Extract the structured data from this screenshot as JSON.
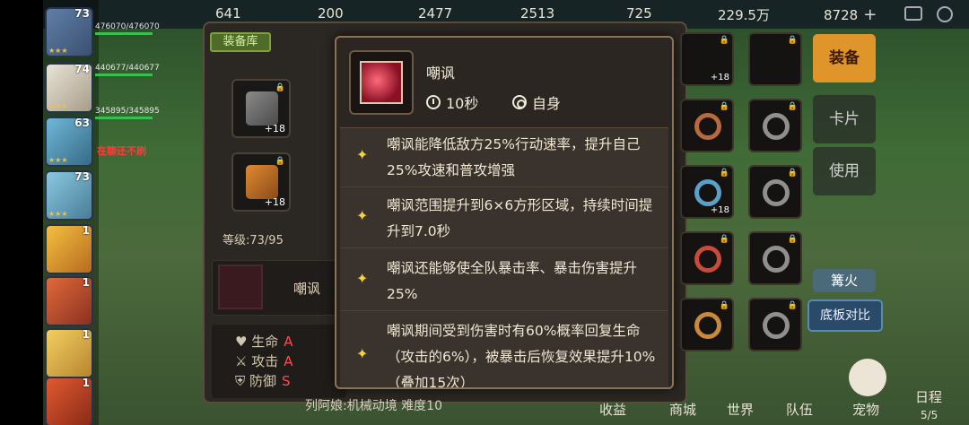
{
  "topbar": {
    "resources": [
      "641",
      "200",
      "2477",
      "2513",
      "725",
      "229.5万",
      "8728"
    ],
    "plus": "+"
  },
  "heroes": [
    {
      "level": "73",
      "hp": "476070/476070"
    },
    {
      "level": "74",
      "hp": "440677/440677"
    },
    {
      "level": "",
      "hp": "345895/345895"
    },
    {
      "level": "63",
      "hp": ""
    },
    {
      "level": "73",
      "hp": ""
    },
    {
      "level": "1",
      "hp": ""
    },
    {
      "level": "1",
      "hp": ""
    },
    {
      "level": "1",
      "hp": ""
    },
    {
      "level": "1",
      "hp": ""
    }
  ],
  "chat_red": "在聊还不刷",
  "equipment_panel": {
    "tab_label": "装备库",
    "slot_plus": "+18",
    "level_label": "等级:73/95",
    "skill_name": "嘲讽",
    "stats": [
      {
        "label": "生命",
        "grade": "A"
      },
      {
        "label": "攻击",
        "grade": "A"
      },
      {
        "label": "防御",
        "grade": "S"
      }
    ]
  },
  "right_menu": {
    "equip": "装备",
    "cards": "卡片",
    "use": "使用",
    "campfire": "篝火",
    "compare": "底板对比",
    "pet": "宠物",
    "schedule": "日程",
    "schedule_count": "5/5"
  },
  "bottom_nav": [
    "收益",
    "商城",
    "世界",
    "队伍"
  ],
  "bottom_chat": "列阿娘:机械动境 难度10",
  "popup": {
    "skill_name": "嘲讽",
    "cooldown": "10秒",
    "target": "自身",
    "effects": [
      "嘲讽能降低敌方25%行动速率，提升自己25%攻速和普攻增强",
      "嘲讽范围提升到6×6方形区域，持续时间提升到7.0秒",
      "嘲讽还能够使全队暴击率、暴击伤害提升25%",
      "嘲讽期间受到伤害时有60%概率回复生命（攻击的6%），被暴击后恢复效果提升10%（叠加15次）"
    ]
  },
  "colors": {
    "popup_bg": "#2c2622",
    "popup_border": "#8b7356",
    "star": "#f4d23b",
    "equip_button": "#e0952a",
    "grade_red": "#ff4d4d"
  }
}
